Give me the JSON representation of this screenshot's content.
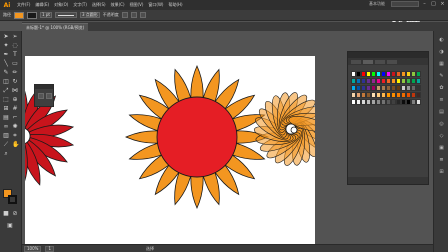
{
  "app": {
    "logo": "Ai",
    "menus": [
      "文件(F)",
      "编辑(E)",
      "对象(O)",
      "文字(T)",
      "选择(S)",
      "效果(C)",
      "视图(V)",
      "窗口(W)",
      "帮助(H)"
    ],
    "workspace_label": "基本功能",
    "window_buttons": [
      "–",
      "□",
      "×"
    ]
  },
  "controlbar": {
    "label": "路径",
    "fill_color": "#f39620",
    "stroke_color": "#1a1a1a",
    "stroke_weight": "1 pt",
    "brush_label": "3 点圆形",
    "opacity_label": "不透明度"
  },
  "document": {
    "tab_label": "未标题-1* @ 100% (RGB/预览)"
  },
  "tools": [
    "selection",
    "direct-selection",
    "magic-wand",
    "lasso",
    "pen",
    "type",
    "line",
    "rectangle",
    "paintbrush",
    "pencil",
    "eraser",
    "rotate",
    "scale",
    "width",
    "free-transform",
    "shape-builder",
    "perspective",
    "mesh",
    "gradient",
    "eyedropper",
    "blend",
    "symbol-sprayer",
    "graph",
    "artboard",
    "slice",
    "hand",
    "zoom"
  ],
  "colors": {
    "petal_orange": "#f39620",
    "center_red": "#e51e25",
    "dark_red": "#c8141c",
    "outline": "#1a1a1a"
  },
  "swatches": {
    "rows": [
      [
        "#ffffff",
        "#000000",
        "#ff0000",
        "#ffff00",
        "#00ff00",
        "#00ffff",
        "#0000ff",
        "#ff00ff",
        "#c8141c",
        "#e85a1e",
        "#f39620",
        "#fcd116",
        "#8cc63f",
        "#00a651"
      ],
      [
        "#00a99d",
        "#0072bc",
        "#2e3192",
        "#662d91",
        "#92278f",
        "#ec008c",
        "#ed1c24",
        "#f26522",
        "#f7941d",
        "#fff200",
        "#8dc63f",
        "#39b54a",
        "#00a651",
        "#00a99d"
      ],
      [
        "#00aeef",
        "#0054a6",
        "#2e3192",
        "#662d91",
        "#9e005d",
        "#c69c6d",
        "#a67c52",
        "#8c6239",
        "#754c24",
        "#603913",
        "#cccccc",
        "#999999",
        "#666666",
        "#333333"
      ],
      [
        "#f5d2a8",
        "#e2a271",
        "#c3793b",
        "#8b5a2b",
        "#ffe0b2",
        "#ffcc80",
        "#ffb74d",
        "#ff9800",
        "#fb8c00",
        "#f57c00",
        "#ef6c00",
        "#e65100",
        "#bf360c",
        "#3e2723"
      ],
      [
        "#ffffff",
        "#f2f2f2",
        "#d9d9d9",
        "#bfbfbf",
        "#a6a6a6",
        "#8c8c8c",
        "#737373",
        "#595959",
        "#404040",
        "#262626",
        "#0d0d0d",
        "#000000",
        "#7f7f7f",
        "#e0e0e0"
      ]
    ]
  },
  "statusbar": {
    "zoom": "100%",
    "page": "1",
    "tool_name": "选择"
  },
  "watermark": "优酷"
}
